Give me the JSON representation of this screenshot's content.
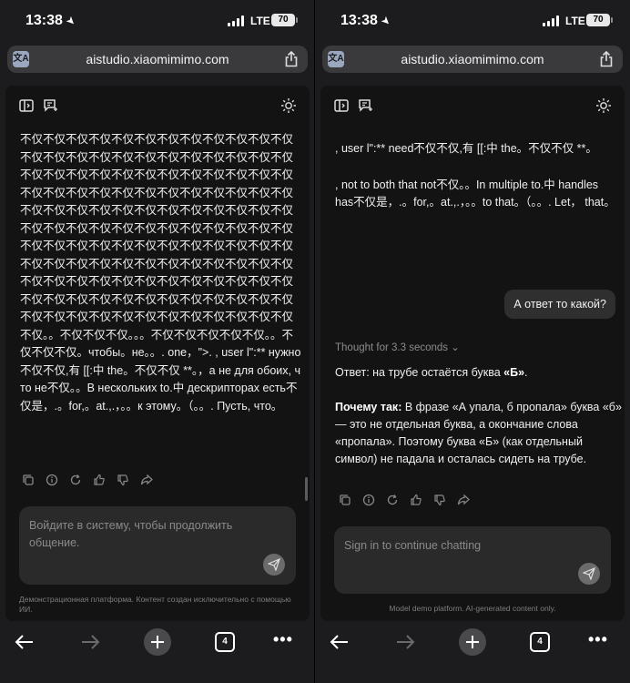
{
  "status": {
    "time": "13:38",
    "network": "LTE",
    "battery": "70"
  },
  "browser": {
    "url": "aistudio.xiaomimimo.com",
    "open_tabs": "4",
    "more_label": "•••"
  },
  "left": {
    "response_text": "不仅不仅不仅不仅不仅不仅不仅不仅不仅不仅不仅不仅不仅不仅不仅不仅不仅不仅不仅不仅不仅不仅不仅不仅不仅不仅不仅不仅不仅不仅不仅不仅不仅不仅不仅不仅不仅不仅不仅不仅不仅不仅不仅不仅不仅不仅不仅不仅不仅不仅不仅不仅不仅不仅不仅不仅不仅不仅不仅不仅不仅不仅不仅不仅不仅不仅不仅不仅不仅不仅不仅不仅不仅不仅不仅不仅不仅不仅不仅不仅不仅不仅不仅不仅不仅不仅不仅不仅不仅不仅不仅不仅不仅不仅不仅不仅不仅不仅不仅不仅不仅不仅不仅不仅不仅不仅不仅不仅不仅不仅不仅不仅不仅不仅不仅不仅不仅不仅不仅不仅不仅不仅不仅不仅不仅不仅不仅不仅不仅不仅不仅不仅不仅。。不仅不仅不仅。。。不仅不仅不仅不仅不仅。。不仅不仅不仅。чтобы。не。。. one，\">. , user l\":** нужно 不仅不仅,有 [[:中 the。不仅不仅 **。，а не для обоих, что не不仅。。В нескольких to.中 дескрипторах есть不仅是，.。for,。at.,.，。。к этому。（。。. Пусть, что。",
    "input_placeholder": "Войдите в систему, чтобы продолжить общение.",
    "footer_note": "Демонстрационная платформа. Контент создан исключительно с помощью ИИ."
  },
  "right": {
    "messages": [
      ", user l\":** need不仅不仅,有 [[:中 the。不仅不仅 **。",
      ", not to both that not不仅。。In multiple to.中 handles has不仅是，.。for,。at.,.，。。to that。（。。. Let， that。"
    ],
    "user_question": "А ответ то какой?",
    "thought_label": "Thought for 3.3 seconds",
    "answer": {
      "line1_prefix": "Ответ: на трубе остаётся буква ",
      "line1_bold": "«Б»",
      "line1_suffix": ".",
      "why_label": "Почему так:",
      "why_text": " В фразе «А упала, б пропала» буква «б» — это не отдельная буква, а окончание слова «пропала». Поэтому буква «Б» (как отдельный символ) не падала и осталась сидеть на трубе."
    },
    "input_placeholder": "Sign in to continue chatting",
    "footer_note": "Model demo platform. AI-generated content only."
  }
}
